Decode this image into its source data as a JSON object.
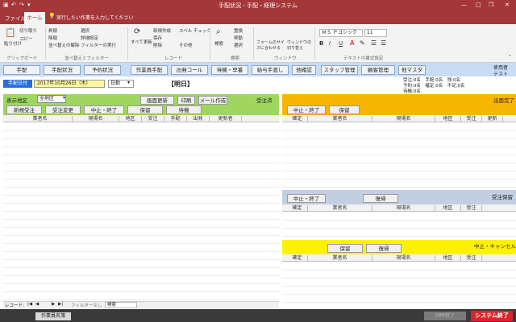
{
  "window": {
    "title": "手配状況 - 手配・経理システム"
  },
  "tabs": {
    "file": "ファイル",
    "home": "ホーム",
    "tell": "実行したい作業を入力してください"
  },
  "ribbon": {
    "clipboard": {
      "group": "クリップボード",
      "paste": "貼り付け",
      "cut": "切り取り",
      "copy": "コピー"
    },
    "sort": {
      "group": "並べ替えとフィルター",
      "asc": "昇順",
      "desc": "降順",
      "clear": "並べ替えの解除",
      "select": "選択",
      "advanced": "詳細設定",
      "toggle": "フィルターの実行"
    },
    "records": {
      "group": "レコード",
      "refresh": "すべて更新",
      "new": "新規作成",
      "save": "保存",
      "delete": "削除",
      "spell": "スペル チェック",
      "more": "その他"
    },
    "find": {
      "group": "検索",
      "find": "検索",
      "replace": "置換",
      "goto": "移動",
      "select": "選択"
    },
    "window": {
      "group": "ウィンドウ",
      "fit": "フォームのサイズに合わせる",
      "switch": "ウィンドウの切り替え"
    },
    "text": {
      "group": "テキストの書式設定",
      "font": "ＭＳ Ｐゴシック",
      "size": "11",
      "bold": "B",
      "italic": "I",
      "underline": "U"
    }
  },
  "nav": {
    "items": [
      "手配",
      "手配状況",
      "予約状況",
      "作業員手配",
      "出発コール",
      "待機・早番",
      "給与手渡し",
      "他確認",
      "スタッフ管理",
      "顧客管理",
      "他マスタ"
    ],
    "user_label": "使用者",
    "user_name": "テスト"
  },
  "date": {
    "label": "手配日付",
    "value": "2017年10月26日（木）",
    "shift": "日勤",
    "heading": "【明日】"
  },
  "summary": {
    "line1": "受注:0名　手配:0名　残:0名",
    "line2": "予約:0名　確定:0名　不足:0名",
    "line3": "待機:0名"
  },
  "left": {
    "area_label": "表示地区",
    "area_value": "全地区",
    "buttons": [
      "新規受注",
      "受注変更",
      "中止・終了",
      "保留",
      "待機"
    ],
    "refresh": "画面更新",
    "print": "印刷",
    "mail": "メール作成",
    "status": "受注済",
    "columns": [
      "業者名",
      "現場名",
      "地区",
      "受注",
      "手配",
      "出発",
      "更新者"
    ]
  },
  "right1": {
    "buttons": [
      "中止・終了",
      "保留"
    ],
    "status": "出面完了",
    "columns": [
      "確定",
      "業者名",
      "現場名",
      "地区",
      "受注",
      "更新"
    ]
  },
  "right2": {
    "buttons": [
      "中止・終了",
      "復帰"
    ],
    "status": "受注保留",
    "columns": [
      "確定",
      "業者名",
      "現場名",
      "地区",
      "受注"
    ]
  },
  "right3": {
    "buttons": [
      "保留",
      "復帰"
    ],
    "status": "中止・キャンセル",
    "columns": [
      "確定",
      "業者名",
      "現場名",
      "地区",
      "受注"
    ]
  },
  "recnav": {
    "label": "レコード:",
    "prefix": "◀",
    "first": "|◀",
    "prev": "◀",
    "next": "▶",
    "last": "▶|",
    "filter": "フィルターなし",
    "search": "検索"
  },
  "bottom": {
    "tab1": "作業員名簿",
    "btn_disabled": "同時終了",
    "btn_end": "システム終了"
  }
}
